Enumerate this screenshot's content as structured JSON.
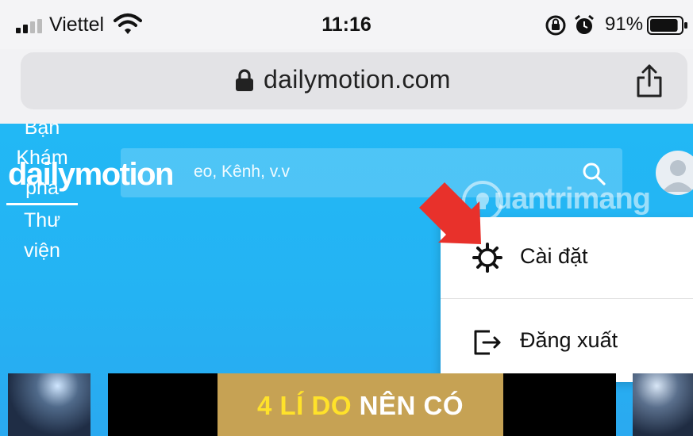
{
  "status_bar": {
    "carrier": "Viettel",
    "time": "11:16",
    "battery_percent": "91%",
    "battery_level": 0.91,
    "icons": [
      "signal-icon",
      "wifi-icon",
      "rotation-lock-icon",
      "alarm-icon",
      "battery-icon"
    ]
  },
  "browser": {
    "url": "dailymotion.com",
    "icons": [
      "lock-icon",
      "share-icon"
    ]
  },
  "site": {
    "nav_items": [
      {
        "label": "Bạn"
      },
      {
        "label": "Khám phá"
      },
      {
        "label": "Thư viện"
      }
    ],
    "logo_text": "dailymotion",
    "search_placeholder": "Video, Kênh, v.v",
    "search_partial": "eo, Kênh, v.v"
  },
  "dropdown": {
    "items": [
      {
        "label": "Cài đặt",
        "icon": "gear-icon"
      },
      {
        "label": "Đăng xuất",
        "icon": "logout-icon"
      }
    ]
  },
  "watermark": {
    "text": "uantrimang"
  },
  "banner": {
    "highlight": "4 LÍ DO",
    "rest": " NÊN CÓ"
  },
  "colors": {
    "page_blue": "#22b8f5",
    "annotation_arrow": "#e8312b",
    "banner_gold": "#c6a254",
    "banner_highlight": "#ffe22a"
  }
}
